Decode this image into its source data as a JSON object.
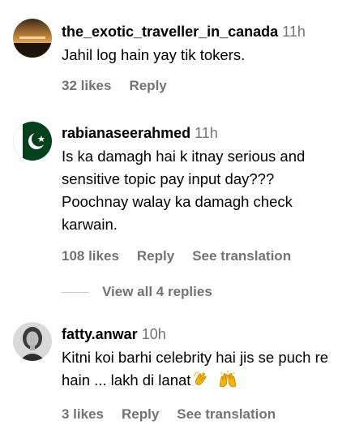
{
  "comments": [
    {
      "username": "the_exotic_traveller_in_canada",
      "time": "11h",
      "text": "Jahil log hain yay tik tokers.",
      "likes": "32 likes",
      "reply": "Reply"
    },
    {
      "username": "rabianaseerahmed",
      "time": "11h",
      "text": "Is ka damagh hai k itnay serious and sensitive topic pay input day??? Poochnay walay ka damagh check karwain.",
      "likes": "108 likes",
      "reply": "Reply",
      "translate": "See translation"
    },
    {
      "username": "fatty.anwar",
      "time": "10h",
      "text": "Kitni koi barhi celebrity hai jis se puch re hain ... lakh di lanat",
      "emojis": [
        "clapping-hands-emoji",
        "raising-hands-emoji"
      ],
      "likes": "3 likes",
      "reply": "Reply",
      "translate": "See translation"
    }
  ],
  "view_replies": "View all 4 replies",
  "colors": {
    "text": "#000000",
    "secondary": "#737373",
    "divider": "#c7c7c7",
    "emoji": "#f4b400"
  }
}
